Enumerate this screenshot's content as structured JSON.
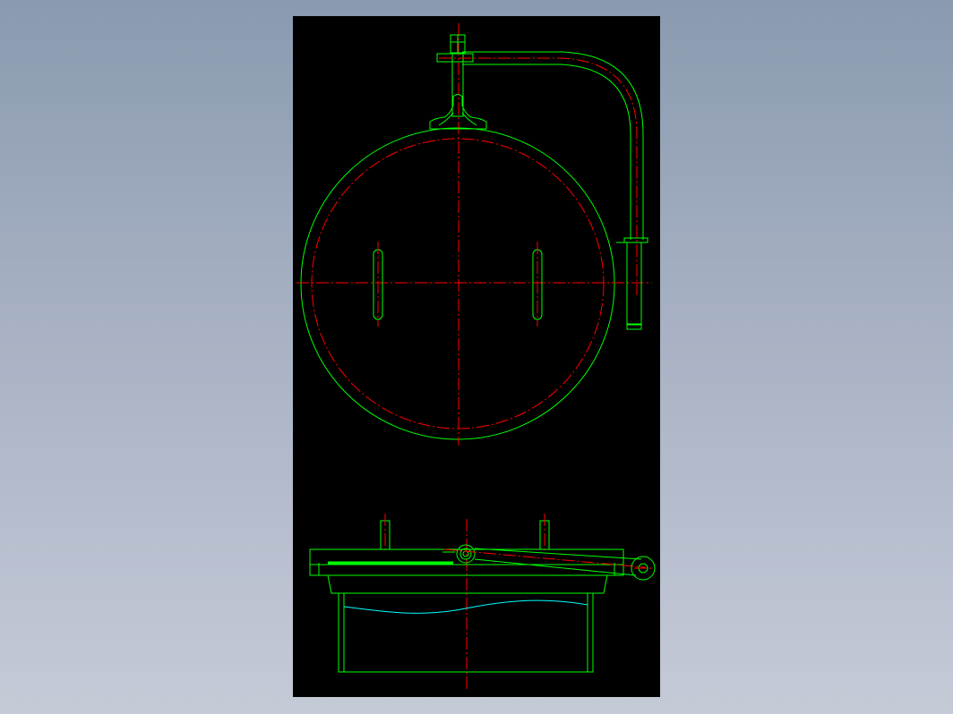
{
  "colors": {
    "background_gradient_top": "#8a9ab0",
    "background_gradient_bottom": "#c5cad7",
    "sheet": "#000000",
    "outline": "#00ff00",
    "centerline": "#ff0000",
    "hidden_edge": "#00ffff"
  },
  "views": [
    "top-view",
    "front-section-view"
  ],
  "text_labels": []
}
